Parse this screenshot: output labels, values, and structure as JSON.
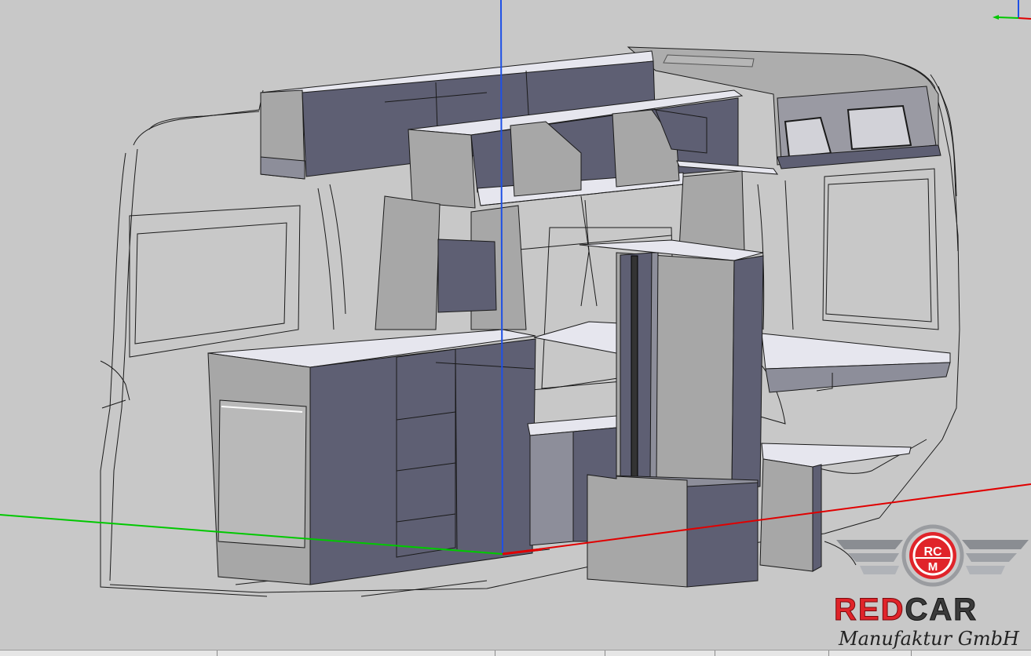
{
  "viewport": {
    "background": "#c8c8c8",
    "view": "3D isometric CAD viewport",
    "axes": {
      "x_color": "#e00000",
      "y_color": "#00c800",
      "z_color": "#1e50e6"
    }
  },
  "logo": {
    "monogram_top": "RC",
    "monogram_bottom": "M",
    "wordmark_red": "RED",
    "wordmark_dark": "CAR",
    "tagline": "Manufaktur GmbH",
    "brand_red": "#e0242a",
    "brand_dark": "#333333"
  },
  "colors": {
    "panel_dark": "#5e5f73",
    "panel_mid": "#8d8e9a",
    "panel_light": "#a7a7a7",
    "top_surface": "#e6e6ee",
    "outline": "#1a1a1a"
  }
}
